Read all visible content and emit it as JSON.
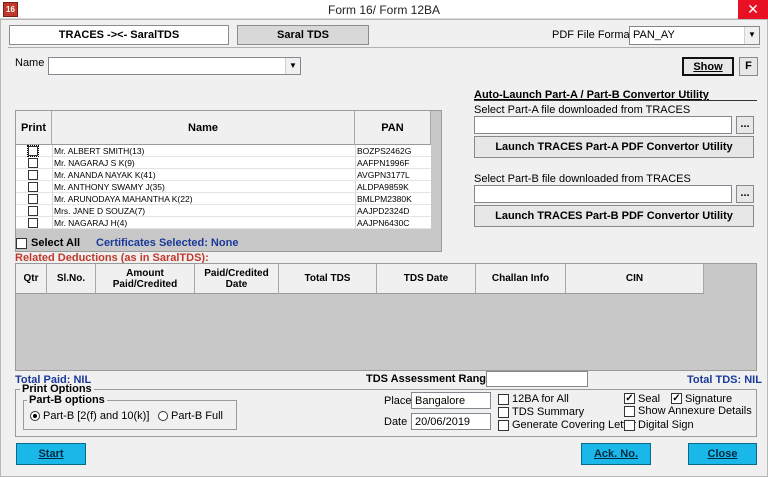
{
  "window": {
    "title": "Form 16/ Form 12BA",
    "icon_text": "16",
    "close_glyph": "✕"
  },
  "tabs": {
    "traces": "TRACES -><- SaralTDS",
    "saral": "Saral TDS"
  },
  "pdf_format": {
    "label": "PDF File Format",
    "value": "PAN_AY"
  },
  "name_filter": {
    "label": "Name",
    "value": ""
  },
  "buttons": {
    "show": "Show",
    "f": "F",
    "browse_a": "...",
    "browse_b": "...",
    "launch_a": "Launch TRACES Part-A PDF Convertor Utility",
    "launch_b": "Launch TRACES Part-B PDF Convertor Utility",
    "start": "Start",
    "ack": "Ack. No.",
    "close": "Close"
  },
  "grid": {
    "headers": {
      "print": "Print",
      "name": "Name",
      "pan": "PAN"
    },
    "rows": [
      {
        "name": "Mr. ALBERT SMITH(13)",
        "pan": "BOZPS2462G"
      },
      {
        "name": "Mr. NAGARAJ  S K(9)",
        "pan": "AAFPN1996F"
      },
      {
        "name": "Mr. ANANDA NAYAK K(41)",
        "pan": "AVGPN3177L"
      },
      {
        "name": "Mr. ANTHONY SWAMY J(35)",
        "pan": "ALDPA9859K"
      },
      {
        "name": "Mr. ARUNODAYA MAHANTHA K(22)",
        "pan": "BMLPM2380K"
      },
      {
        "name": "Mrs. JANE D SOUZA(7)",
        "pan": "AAJPD2324D"
      },
      {
        "name": "Mr. NAGARAJ H(4)",
        "pan": "AAJPN6430C"
      }
    ]
  },
  "autolaunch": {
    "title": "Auto-Launch Part-A / Part-B Convertor Utility",
    "part_a_label": "Select Part-A file downloaded from TRACES",
    "part_b_label": "Select Part-B file downloaded from TRACES",
    "part_a_value": "",
    "part_b_value": ""
  },
  "select_all": "Select All",
  "certificates_selected": "Certificates Selected: None",
  "deductions": {
    "title": "Related Deductions (as in SaralTDS):",
    "headers": [
      "Qtr",
      "Sl.No.",
      "Amount Paid/Credited",
      "Paid/Credited Date",
      "Total TDS",
      "TDS Date",
      "Challan Info",
      "CIN"
    ]
  },
  "totals": {
    "paid": "Total Paid: NIL",
    "tds": "Total TDS: NIL",
    "range_label": "TDS Assessment Range",
    "range_value": ""
  },
  "print_options": {
    "title": "Print Options",
    "partb_title": "Part-B options",
    "radio1": "Part-B [2(f) and 10(k)]",
    "radio2": "Part-B Full",
    "place_label": "Place",
    "place_value": "Bangalore",
    "date_label": "Date",
    "date_value": "20/06/2019",
    "cb_12ba": "12BA for All",
    "cb_summary": "TDS Summary",
    "cb_covering": "Generate Covering Letter",
    "cb_seal": "Seal",
    "cb_signature": "Signature",
    "cb_annexure": "Show Annexure Details",
    "cb_digital": "Digital Sign",
    "check_glyph": "✓",
    "seal_checked": true,
    "signature_checked": true
  }
}
